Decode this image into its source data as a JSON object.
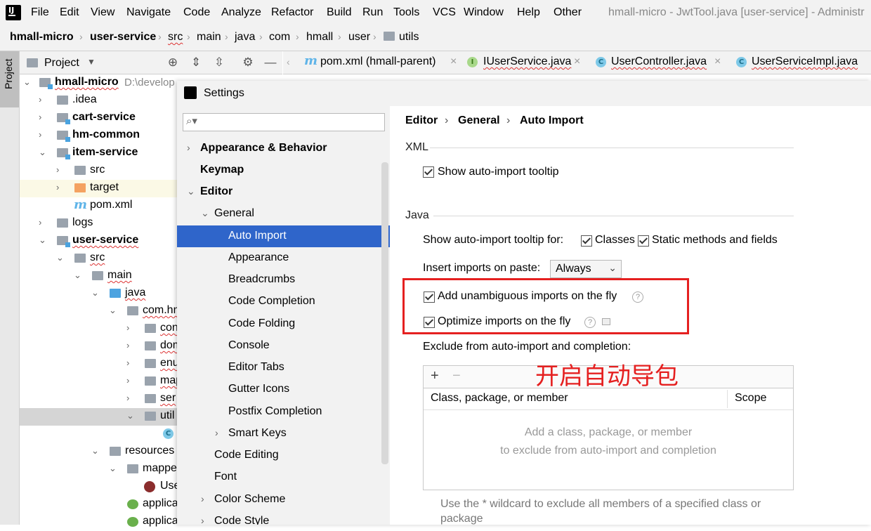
{
  "menubar": {
    "items": [
      "File",
      "Edit",
      "View",
      "Navigate",
      "Code",
      "Analyze",
      "Refactor",
      "Build",
      "Run",
      "Tools",
      "VCS",
      "Window",
      "Help",
      "Other"
    ],
    "window_title": "hmall-micro - JwtTool.java [user-service] - Administr"
  },
  "navbar": {
    "crumbs": [
      "hmall-micro",
      "user-service",
      "src",
      "main",
      "java",
      "com",
      "hmall",
      "user",
      "utils"
    ]
  },
  "stripe": {
    "project_tab": "Project"
  },
  "project_panel": {
    "title": "Project",
    "tree": [
      {
        "label": "hmall-micro",
        "path": "D:\\develop",
        "bold": true
      },
      {
        "label": ".idea"
      },
      {
        "label": "cart-service",
        "bold": true
      },
      {
        "label": "hm-common",
        "bold": true
      },
      {
        "label": "item-service",
        "bold": true
      },
      {
        "label": "src"
      },
      {
        "label": "target"
      },
      {
        "label": "pom.xml"
      },
      {
        "label": "logs"
      },
      {
        "label": "user-service",
        "bold": true
      },
      {
        "label": "src"
      },
      {
        "label": "main"
      },
      {
        "label": "java"
      },
      {
        "label": "com.hm"
      },
      {
        "label": "con"
      },
      {
        "label": "dom"
      },
      {
        "label": "enu"
      },
      {
        "label": "map"
      },
      {
        "label": "ser"
      },
      {
        "label": "util"
      },
      {
        "label": ""
      },
      {
        "label": "resources"
      },
      {
        "label": "mappe"
      },
      {
        "label": "Use"
      },
      {
        "label": "applica"
      },
      {
        "label": "applica"
      }
    ]
  },
  "editor_tabs": [
    {
      "label": "pom.xml (hmall-parent)",
      "icon": "m"
    },
    {
      "label": "IUserService.java",
      "icon": "I"
    },
    {
      "label": "UserController.java",
      "icon": "C"
    },
    {
      "label": "UserServiceImpl.java",
      "icon": "C"
    }
  ],
  "settings": {
    "title": "Settings",
    "search_placeholder": "",
    "nav": [
      {
        "label": "Appearance & Behavior",
        "bold": true
      },
      {
        "label": "Keymap",
        "bold": true
      },
      {
        "label": "Editor",
        "bold": true
      },
      {
        "label": "General"
      },
      {
        "label": "Auto Import",
        "selected": true
      },
      {
        "label": "Appearance"
      },
      {
        "label": "Breadcrumbs"
      },
      {
        "label": "Code Completion"
      },
      {
        "label": "Code Folding"
      },
      {
        "label": "Console"
      },
      {
        "label": "Editor Tabs"
      },
      {
        "label": "Gutter Icons"
      },
      {
        "label": "Postfix Completion"
      },
      {
        "label": "Smart Keys"
      },
      {
        "label": "Code Editing"
      },
      {
        "label": "Font"
      },
      {
        "label": "Color Scheme"
      },
      {
        "label": "Code Style"
      }
    ],
    "breadcrumb": [
      "Editor",
      "General",
      "Auto Import"
    ],
    "xml_section": "XML",
    "xml_show_tooltip": "Show auto-import tooltip",
    "java_section": "Java",
    "java_tooltip_for": "Show auto-import tooltip for:",
    "java_classes": "Classes",
    "java_static": "Static methods and fields",
    "insert_on_paste_label": "Insert imports on paste:",
    "insert_on_paste_value": "Always",
    "add_unambiguous": "Add unambiguous imports on the fly",
    "optimize_imports": "Optimize imports on the fly",
    "exclude_label": "Exclude from auto-import and completion:",
    "table_add": "+",
    "table_remove": "−",
    "col_member": "Class, package, or member",
    "col_scope": "Scope",
    "empty_line1": "Add a class, package, or member",
    "empty_line2": "to exclude from auto-import and completion",
    "wildcard_hint": "Use the * wildcard to exclude all members of a specified class or package"
  },
  "annotation": "开启自动导包",
  "colors": {
    "accent": "#2f65ca",
    "highlight_box": "#e52020"
  }
}
